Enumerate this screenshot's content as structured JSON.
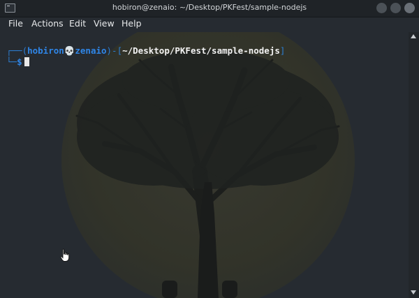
{
  "window": {
    "title": "hobiron@zenaio: ~/Desktop/PKFest/sample-nodejs",
    "icon": "terminal-icon"
  },
  "menu": {
    "items": [
      {
        "label": "File"
      },
      {
        "label": "Actions"
      },
      {
        "label": "Edit"
      },
      {
        "label": "View"
      },
      {
        "label": "Help"
      }
    ]
  },
  "terminal": {
    "prompt_line1": {
      "frame_open": "┌──(",
      "user": "hobiron",
      "separator_icon": "skull-icon",
      "separator": "💀",
      "host": "zenaio",
      "frame_mid": ")-[",
      "path": "~/Desktop/PKFest/sample-nodejs",
      "frame_close": "]"
    },
    "prompt_line2": {
      "frame": "└─",
      "symbol": "$"
    },
    "input_value": ""
  },
  "colors": {
    "prompt_frame": "#2c7fd4",
    "prompt_user": "#2f86e8",
    "path": "#f2f2f2",
    "background": "#262b31"
  }
}
